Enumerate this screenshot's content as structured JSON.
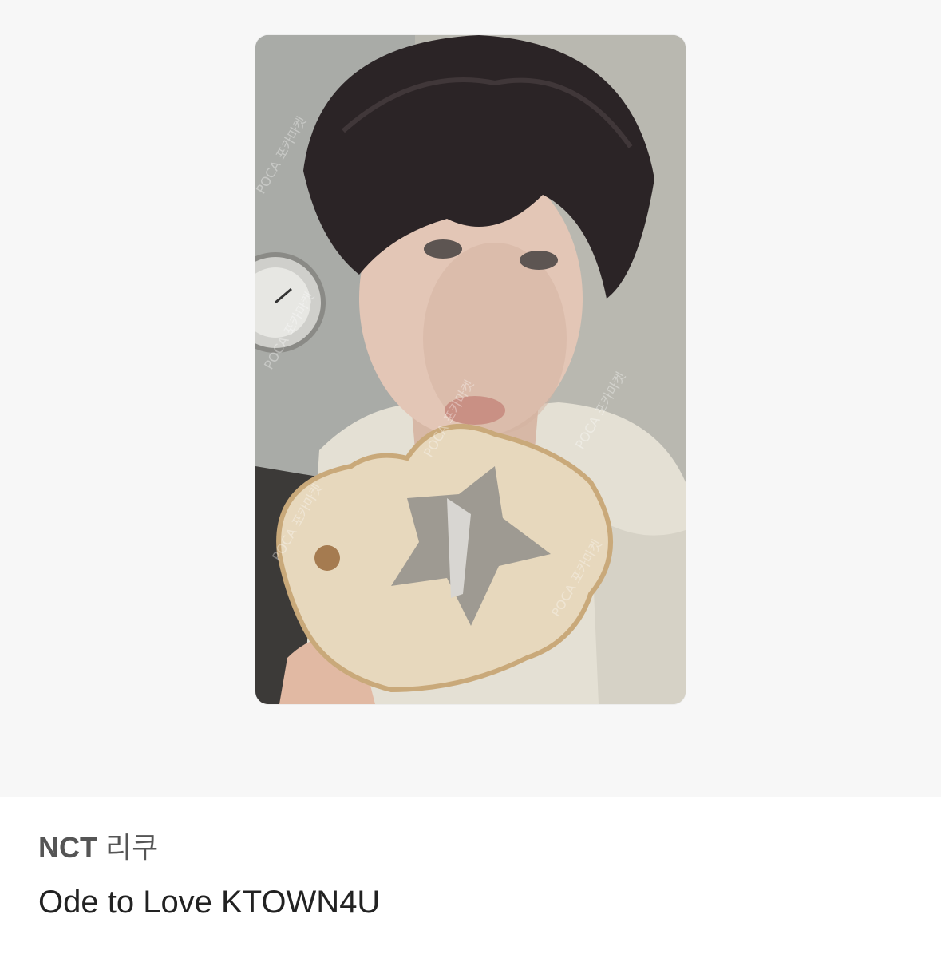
{
  "photocard": {
    "image_alt": "Photocard: person biting a slice of bread with a star-shaped hole",
    "watermark_text": "POCA 포카마켓"
  },
  "product": {
    "artist": "NCT",
    "member": "리쿠",
    "title": "Ode to Love KTOWN4U"
  }
}
